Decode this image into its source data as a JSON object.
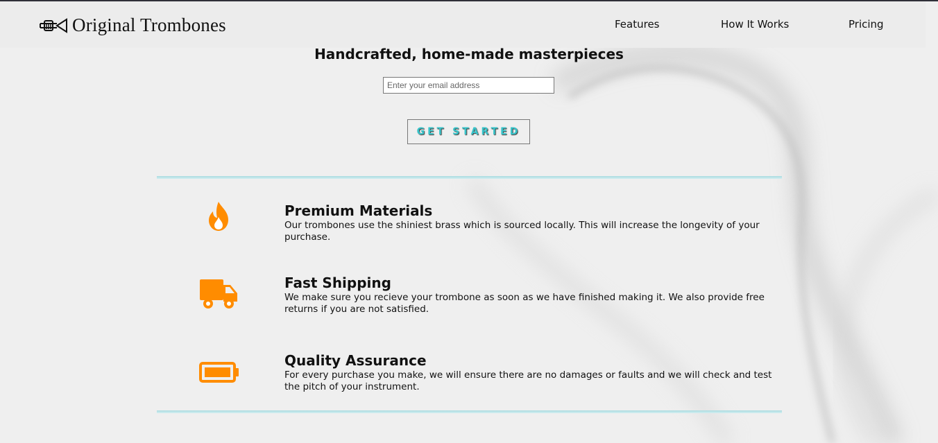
{
  "header": {
    "logo_text": "Original Trombones",
    "nav": [
      {
        "label": "Features"
      },
      {
        "label": "How It Works"
      },
      {
        "label": "Pricing"
      }
    ]
  },
  "hero": {
    "title": "Handcrafted, home-made masterpieces",
    "email_placeholder": "Enter your email address",
    "cta_label": "GET STARTED"
  },
  "features": [
    {
      "icon": "fire-icon",
      "title": "Premium Materials",
      "desc": "Our trombones use the shiniest brass which is sourced locally. This will increase the longevity of your purchase."
    },
    {
      "icon": "truck-icon",
      "title": "Fast Shipping",
      "desc": "We make sure you recieve your trombone as soon as we have finished making it. We also provide free returns if you are not satisfied."
    },
    {
      "icon": "battery-icon",
      "title": "Quality Assurance",
      "desc": "For every purchase you make, we will ensure there are no damages or faults and we will check and test the pitch of your instrument."
    }
  ],
  "colors": {
    "accent_orange": "#ff8c00",
    "cta_text": "#37c3c9",
    "rule": "#a9dbe0"
  }
}
